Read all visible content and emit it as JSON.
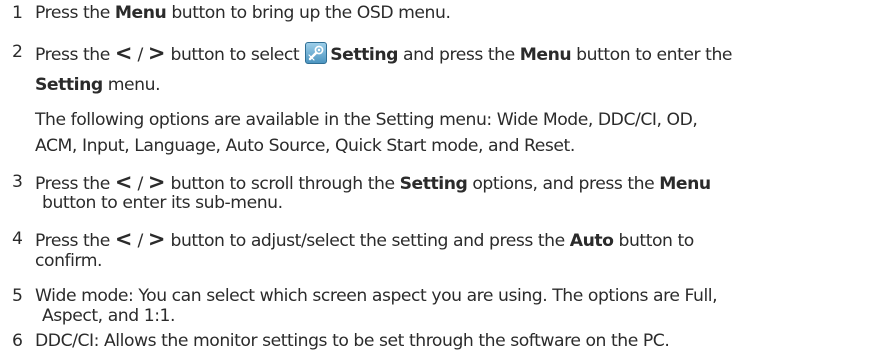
{
  "steps": [
    {
      "number": "1",
      "lines": [
        {
          "t1": "Press the ",
          "b1": "Menu",
          "t2": " button to bring up the OSD menu."
        }
      ]
    },
    {
      "number": "2",
      "lines": [
        {
          "t1": "Press the ",
          "arrow_left": "<",
          "slash": " / ",
          "arrow_right": ">",
          "t2": " button to select ",
          "b1": "Setting",
          "t3": " and press the ",
          "b2": "Menu",
          "t4": " button to enter the"
        },
        {
          "b1": "Setting",
          "t1": " menu."
        },
        {
          "t1": "The following options are available in the Setting menu: Wide Mode, DDC/CI, OD,"
        },
        {
          "t1": "ACM, Input, Language, Auto Source, Quick Start mode, and Reset."
        }
      ]
    },
    {
      "number": "3",
      "lines": [
        {
          "t1": "Press the ",
          "arrow_left": "<",
          "slash": " / ",
          "arrow_right": ">",
          "t2": " button to scroll through the ",
          "b1": "Setting",
          "t3": " options, and press the ",
          "b2": "Menu"
        },
        {
          "t1": "button to enter its sub-menu."
        }
      ]
    },
    {
      "number": "4",
      "lines": [
        {
          "t1": "Press the ",
          "arrow_left": "<",
          "slash": " / ",
          "arrow_right": ">",
          "t2": " button to adjust/select the setting and press the ",
          "b1": "Auto",
          "t3": " button to"
        },
        {
          "t1": "confirm."
        }
      ]
    },
    {
      "number": "5",
      "lines": [
        {
          "t1": "Wide mode: You can select which screen aspect you are using. The options are Full,"
        },
        {
          "t1": "Aspect, and 1:1."
        }
      ]
    },
    {
      "number": "6",
      "lines": [
        {
          "t1": "DDC/CI: Allows the monitor settings to be set through the software on the PC."
        }
      ]
    }
  ],
  "icons": {
    "setting": "wrench-gear-icon"
  },
  "colors": {
    "text": "#2b2b2b",
    "icon_bg": "#6fb1d4",
    "icon_border": "#2f6f95"
  }
}
